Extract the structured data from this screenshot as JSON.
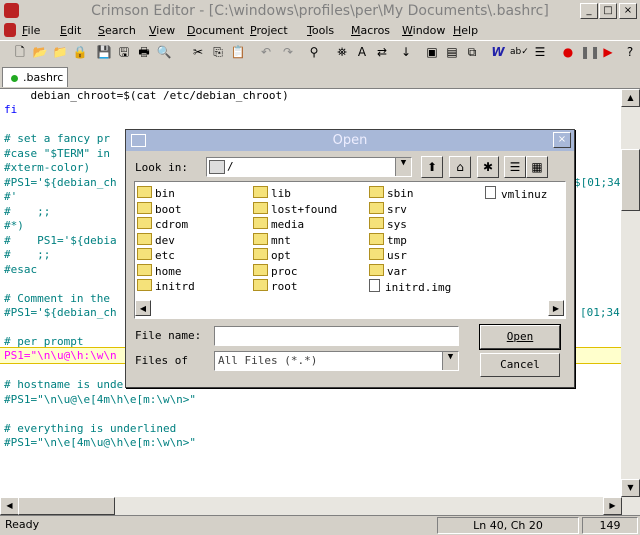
{
  "window": {
    "title": "Crimson Editor - [C:\\windows\\profiles\\per\\My Documents\\.bashrc]",
    "min": "_",
    "max": "□",
    "close": "×"
  },
  "menu": [
    "File",
    "Edit",
    "Search",
    "View",
    "Document",
    "Project",
    "Tools",
    "Macros",
    "Window",
    "Help"
  ],
  "tab": {
    "label": ".bashrc"
  },
  "editor_lines": [
    {
      "text": "    debian_chroot=$(cat /etc/debian_chroot)",
      "color": "#000000"
    },
    {
      "text": "fi",
      "color": "#0000ff"
    },
    {
      "text": "",
      "color": "#000000"
    },
    {
      "text": "# set a fancy pr",
      "color": "#008080"
    },
    {
      "text": "#case \"$TERM\" in",
      "color": "#008080"
    },
    {
      "text": "#xterm-color)",
      "color": "#008080"
    },
    {
      "text": "#PS1='${debian_ch",
      "color": "#008080"
    },
    {
      "text": "#'",
      "color": "#008080"
    },
    {
      "text": "#    ;;",
      "color": "#008080"
    },
    {
      "text": "#*)",
      "color": "#008080"
    },
    {
      "text": "#    PS1='${debia",
      "color": "#008080"
    },
    {
      "text": "#    ;;",
      "color": "#008080"
    },
    {
      "text": "#esac",
      "color": "#008080"
    },
    {
      "text": "",
      "color": "#000000"
    },
    {
      "text": "# Comment in the",
      "color": "#008080"
    },
    {
      "text": "#PS1='${debian_ch",
      "color": "#008080"
    },
    {
      "text": "",
      "color": "#000000"
    },
    {
      "text": "# per prompt",
      "color": "#008080"
    },
    {
      "text": "PS1=\"\\n\\u@\\h:\\w\\n",
      "color": "#ff00ff"
    },
    {
      "text": "",
      "color": "#000000"
    },
    {
      "text": "# hostname is underlined",
      "color": "#008080"
    },
    {
      "text": "#PS1=\"\\n\\u@\\e[4m\\h\\e[m:\\w\\n>\"",
      "color": "#008080"
    },
    {
      "text": "",
      "color": "#000000"
    },
    {
      "text": "# everything is underlined",
      "color": "#008080"
    },
    {
      "text": "#PS1=\"\\n\\e[4m\\u@\\h\\e[m:\\w\\n>\"",
      "color": "#008080"
    }
  ],
  "right_fragments": [
    "$[01;34",
    "[01;34"
  ],
  "status": {
    "ready": "Ready",
    "position": "Ln 40, Ch 20",
    "count": "149"
  },
  "dialog": {
    "title": "Open",
    "look_in_label": "Look in:",
    "look_in_value": "/",
    "file_name_label": "File name:",
    "file_name_value": "",
    "files_of_label": "Files of",
    "files_of_value": "All Files (*.*)",
    "open_label": "Open",
    "cancel_label": "Cancel",
    "columns": [
      [
        {
          "name": "bin",
          "type": "folder"
        },
        {
          "name": "boot",
          "type": "folder"
        },
        {
          "name": "cdrom",
          "type": "folder"
        },
        {
          "name": "dev",
          "type": "folder"
        },
        {
          "name": "etc",
          "type": "folder"
        },
        {
          "name": "home",
          "type": "folder"
        },
        {
          "name": "initrd",
          "type": "folder"
        }
      ],
      [
        {
          "name": "lib",
          "type": "folder"
        },
        {
          "name": "lost+found",
          "type": "folder"
        },
        {
          "name": "media",
          "type": "folder"
        },
        {
          "name": "mnt",
          "type": "folder"
        },
        {
          "name": "opt",
          "type": "folder"
        },
        {
          "name": "proc",
          "type": "folder"
        },
        {
          "name": "root",
          "type": "folder"
        }
      ],
      [
        {
          "name": "sbin",
          "type": "folder"
        },
        {
          "name": "srv",
          "type": "folder"
        },
        {
          "name": "sys",
          "type": "folder"
        },
        {
          "name": "tmp",
          "type": "folder"
        },
        {
          "name": "usr",
          "type": "folder"
        },
        {
          "name": "var",
          "type": "folder"
        },
        {
          "name": "initrd.img",
          "type": "file"
        }
      ],
      [
        {
          "name": "vmlinuz",
          "type": "file"
        }
      ]
    ]
  }
}
